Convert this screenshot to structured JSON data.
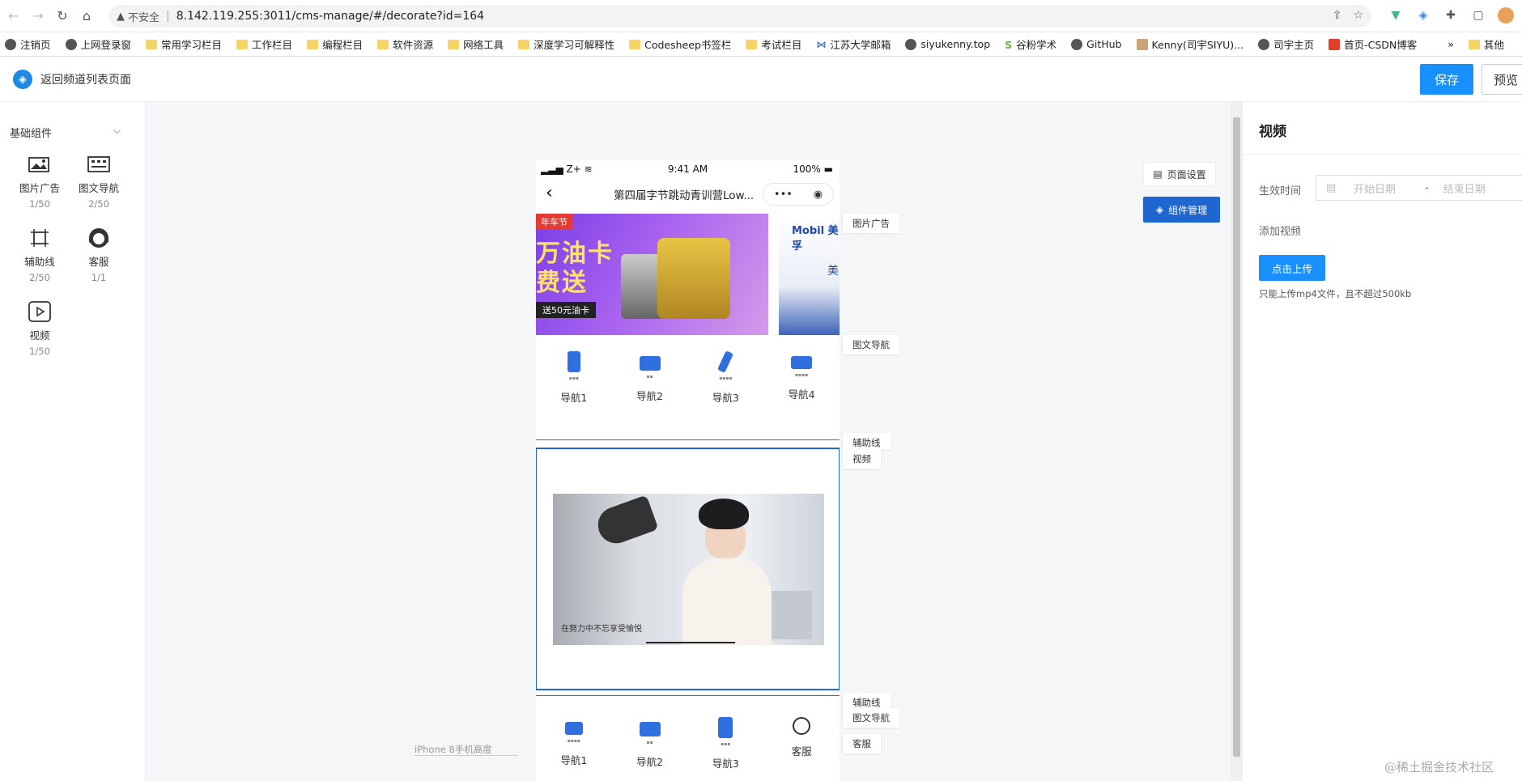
{
  "browser": {
    "insecure_label": "不安全",
    "url": "8.142.119.255:3011/cms-manage/#/decorate?id=164",
    "bookmarks": [
      "注销页",
      "上网登录窗",
      "常用学习栏目",
      "工作栏目",
      "编程栏目",
      "软件资源",
      "网络工具",
      "深度学习可解释性",
      "Codesheep书签栏",
      "考试栏目",
      "江苏大学邮箱",
      "siyukenny.top",
      "谷粉学术",
      "GitHub",
      "Kenny(司宇SIYU)...",
      "司宇主页",
      "首页-CSDN博客"
    ],
    "more": "»",
    "other_bookmarks": "其他"
  },
  "header": {
    "back_label": "返回频道列表页面",
    "save_label": "保存",
    "preview_label": "预览"
  },
  "left_panel": {
    "section_title": "基础组件",
    "components": [
      {
        "name": "图片广告",
        "count": "1/50"
      },
      {
        "name": "图文导航",
        "count": "2/50"
      },
      {
        "name": "辅助线",
        "count": "2/50"
      },
      {
        "name": "客服",
        "count": "1/1"
      },
      {
        "name": "视频",
        "count": "1/50"
      }
    ]
  },
  "phone": {
    "signal": "Z+",
    "time": "9:41 AM",
    "battery": "100%",
    "title": "第四届字节跳动青训营Low...",
    "capsule_more": "•••",
    "banner": {
      "tag": "年车节",
      "big_line1": "万油卡",
      "big_line2": "费送",
      "small": "送50元油卡",
      "next_brand": "Mobil 美孚",
      "next_char": "美"
    },
    "nav1": [
      "导航1",
      "导航2",
      "导航3",
      "导航4"
    ],
    "nav2": [
      "导航1",
      "导航2",
      "导航3",
      "客服"
    ],
    "video_subtitle": "在努力中不忘享受愉悦"
  },
  "side_tags": {
    "image_ad": "图片广告",
    "image_nav": "图文导航",
    "guide_line": "辅助线",
    "video": "视频",
    "guide_line2": "辅助线",
    "image_nav2": "图文导航",
    "service": "客服"
  },
  "canvas": {
    "page_settings": "页面设置",
    "component_manage": "组件管理",
    "height_label": "iPhone 8手机高度"
  },
  "right_panel": {
    "title": "视频",
    "effective_time_label": "生效时间",
    "start_placeholder": "开始日期",
    "range_sep": "-",
    "end_placeholder": "结束日期",
    "add_video_label": "添加视频",
    "upload_label": "点击上传",
    "upload_hint": "只能上传mp4文件，且不超过500kb"
  },
  "watermark": "@稀土掘金技术社区",
  "colors": {
    "primary": "#1890ff",
    "selected_border": "#1e66d0"
  }
}
